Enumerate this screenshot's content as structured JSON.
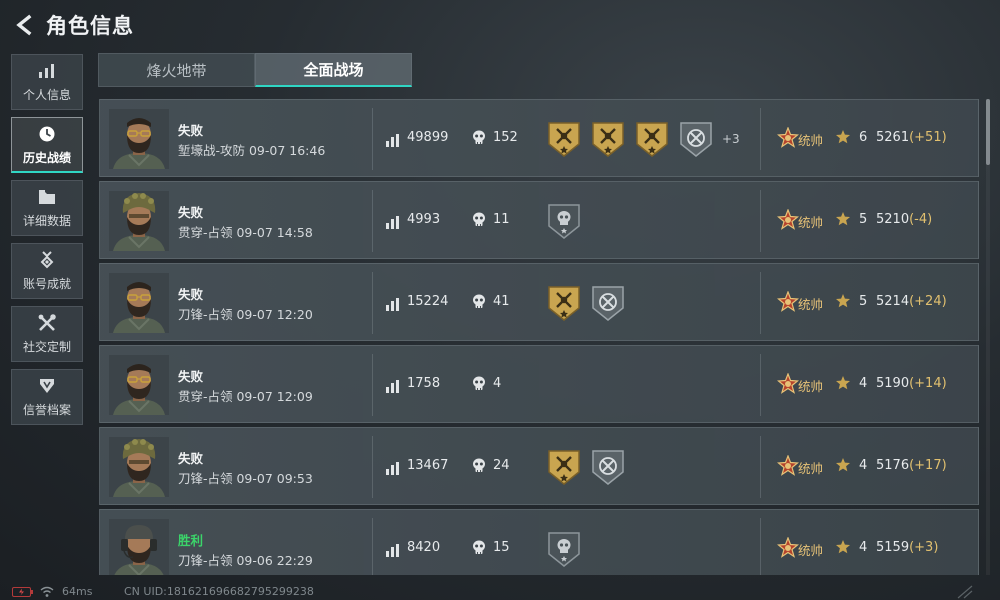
{
  "header": {
    "title": "角色信息",
    "back_icon": "back-arrow-icon"
  },
  "sidebar": {
    "items": [
      {
        "label": "个人信息",
        "icon": "bar-chart-icon",
        "active": false
      },
      {
        "label": "历史战绩",
        "icon": "clock-icon",
        "active": true
      },
      {
        "label": "详细数据",
        "icon": "folder-icon",
        "active": false
      },
      {
        "label": "账号成就",
        "icon": "medal-icon",
        "active": false
      },
      {
        "label": "社交定制",
        "icon": "tools-icon",
        "active": false
      },
      {
        "label": "信誉档案",
        "icon": "shield-icon",
        "active": false
      }
    ]
  },
  "tabs": [
    {
      "label": "烽火地带",
      "active": false
    },
    {
      "label": "全面战场",
      "active": true
    }
  ],
  "matches": [
    {
      "result": "失败",
      "win": false,
      "mode_time": "堑壕战-攻防 09-07 16:46",
      "score": "49899",
      "kills": "152",
      "medals": [
        "gold",
        "gold",
        "gold",
        "silver"
      ],
      "more": "+3",
      "rank": "统帅",
      "level": "6",
      "elo": "5261",
      "delta": "(+51)",
      "avatar": "glasses"
    },
    {
      "result": "失败",
      "win": false,
      "mode_time": "贯穿-占领 09-07 14:58",
      "score": "4993",
      "kills": "11",
      "medals": [
        "skull-silver"
      ],
      "more": "",
      "rank": "统帅",
      "level": "5",
      "elo": "5210",
      "delta": "(-4)",
      "avatar": "headdress"
    },
    {
      "result": "失败",
      "win": false,
      "mode_time": "刀锋-占领 09-07 12:20",
      "score": "15224",
      "kills": "41",
      "medals": [
        "gold",
        "silver"
      ],
      "more": "",
      "rank": "统帅",
      "level": "5",
      "elo": "5214",
      "delta": "(+24)",
      "avatar": "glasses"
    },
    {
      "result": "失败",
      "win": false,
      "mode_time": "贯穿-占领 09-07 12:09",
      "score": "1758",
      "kills": "4",
      "medals": [],
      "more": "",
      "rank": "统帅",
      "level": "4",
      "elo": "5190",
      "delta": "(+14)",
      "avatar": "glasses"
    },
    {
      "result": "失败",
      "win": false,
      "mode_time": "刀锋-占领 09-07 09:53",
      "score": "13467",
      "kills": "24",
      "medals": [
        "gold",
        "silver"
      ],
      "more": "",
      "rank": "统帅",
      "level": "4",
      "elo": "5176",
      "delta": "(+17)",
      "avatar": "headdress"
    },
    {
      "result": "胜利",
      "win": true,
      "mode_time": "刀锋-占领 09-06 22:29",
      "score": "8420",
      "kills": "15",
      "medals": [
        "skull-silver"
      ],
      "more": "",
      "rank": "统帅",
      "level": "4",
      "elo": "5159",
      "delta": "(+3)",
      "avatar": "headset"
    }
  ],
  "footer": {
    "ping": "64ms",
    "uid": "CN UID:181621696682795299238"
  },
  "colors": {
    "accent": "#2fd6c4",
    "win": "#3bd46a",
    "gold": "#c9a550",
    "rank": "#e7c277"
  }
}
